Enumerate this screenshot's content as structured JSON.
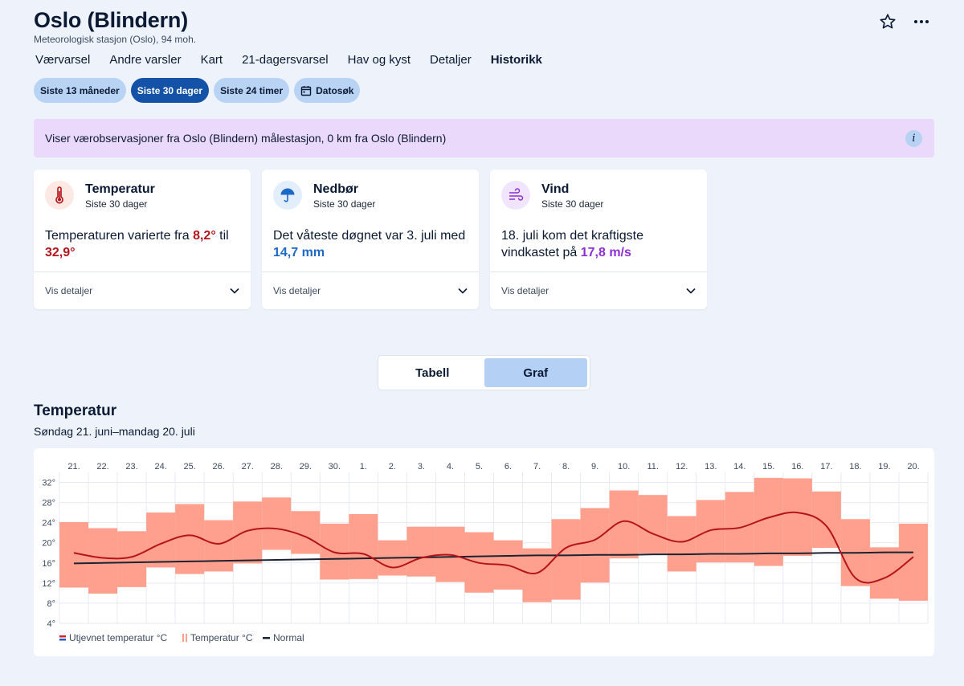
{
  "header": {
    "title": "Oslo (Blindern)",
    "subtitle": "Meteorologisk stasjon (Oslo), 94 moh."
  },
  "actions": {
    "favorite_icon": "star-icon",
    "more_icon": "more-icon"
  },
  "nav": {
    "items": [
      "Værvarsel",
      "Andre varsler",
      "Kart",
      "21-dagersvarsel",
      "Hav og kyst",
      "Detaljer",
      "Historikk"
    ],
    "active": "Historikk"
  },
  "periods": {
    "items": [
      "Siste 13 måneder",
      "Siste 30 dager",
      "Siste 24 timer"
    ],
    "active": "Siste 30 dager",
    "date_search": "Datosøk"
  },
  "info": {
    "text": "Viser værobservasjoner fra Oslo (Blindern) målestasjon, 0 km fra Oslo (Blindern)",
    "icon": "i"
  },
  "cards": [
    {
      "title": "Temperatur",
      "subtitle": "Siste 30 dager",
      "text_before": "Temperaturen varierte fra ",
      "value1": "8,2°",
      "text_mid": " til ",
      "value2": "32,9°",
      "text_after": "",
      "footer": "Vis detaljer",
      "color": "#b4141b"
    },
    {
      "title": "Nedbør",
      "subtitle": "Siste 30 dager",
      "text_before": "Det våteste døgnet var 3. juli med ",
      "value1": "14,7 mm",
      "text_mid": "",
      "value2": "",
      "text_after": "",
      "footer": "Vis detaljer",
      "color": "#1c69c8"
    },
    {
      "title": "Vind",
      "subtitle": "Siste 30 dager",
      "text_before": "18. juli kom det kraftigste vindkastet på ",
      "value1": "17,8 m/s",
      "text_mid": "",
      "value2": "",
      "text_after": "",
      "footer": "Vis detaljer",
      "color": "#8c2fd8"
    }
  ],
  "view_toggle": {
    "table": "Tabell",
    "graph": "Graf",
    "active": "Graf"
  },
  "chart_section": {
    "title": "Temperatur",
    "range": "Søndag 21. juni–mandag 20. juli"
  },
  "chart_data": {
    "type": "bar",
    "categories": [
      "21.",
      "22.",
      "23.",
      "24.",
      "25.",
      "26.",
      "27.",
      "28.",
      "29.",
      "30.",
      "1.",
      "2.",
      "3.",
      "4.",
      "5.",
      "6.",
      "7.",
      "8.",
      "9.",
      "10.",
      "11.",
      "12.",
      "13.",
      "14.",
      "15.",
      "16.",
      "17.",
      "18.",
      "19.",
      "20."
    ],
    "yticks": [
      32,
      28,
      24,
      20,
      16,
      12,
      8,
      4
    ],
    "ytick_suffix": "°",
    "ylim": [
      4,
      34
    ],
    "series": [
      {
        "name": "Temperatur °C",
        "kind": "range",
        "min": [
          11.1,
          9.9,
          11.2,
          15.1,
          13.8,
          14.3,
          15.9,
          18.6,
          17.8,
          12.7,
          12.8,
          13.5,
          13.3,
          12.2,
          10.1,
          10.7,
          8.2,
          8.7,
          12.1,
          16.9,
          17.9,
          14.3,
          16.1,
          16.1,
          15.4,
          17.4,
          19.0,
          11.4,
          8.9,
          8.5
        ],
        "max": [
          24.1,
          22.9,
          22.3,
          26.0,
          27.7,
          24.5,
          28.2,
          29.0,
          26.3,
          23.8,
          25.7,
          20.5,
          23.2,
          23.2,
          22.1,
          20.5,
          18.9,
          24.7,
          26.9,
          30.4,
          29.5,
          25.3,
          28.5,
          30.1,
          32.9,
          32.8,
          30.2,
          24.7,
          19.1,
          23.8
        ],
        "color": "#ffa08e"
      },
      {
        "name": "Utjevnet temperatur °C",
        "kind": "line",
        "values": [
          18.0,
          17.0,
          17.2,
          19.8,
          21.5,
          19.8,
          22.4,
          22.8,
          21.2,
          18.1,
          17.8,
          15.1,
          17.0,
          17.6,
          16.0,
          15.5,
          14.0,
          19.0,
          20.6,
          24.3,
          21.8,
          20.2,
          22.5,
          23.0,
          25.0,
          26.0,
          23.3,
          13.0,
          13.0,
          17.2
        ],
        "color": "#b4141b"
      },
      {
        "name": "Normal",
        "kind": "line",
        "values": [
          15.9,
          16.0,
          16.1,
          16.2,
          16.3,
          16.4,
          16.5,
          16.6,
          16.7,
          16.8,
          16.9,
          17.0,
          17.1,
          17.2,
          17.3,
          17.4,
          17.5,
          17.5,
          17.6,
          17.6,
          17.7,
          17.7,
          17.8,
          17.8,
          17.9,
          17.9,
          18.0,
          18.0,
          18.1,
          18.1
        ],
        "color": "#1b2330"
      }
    ],
    "legend": [
      "Utjevnet temperatur °C",
      "Temperatur °C",
      "Normal"
    ],
    "grid": true
  }
}
